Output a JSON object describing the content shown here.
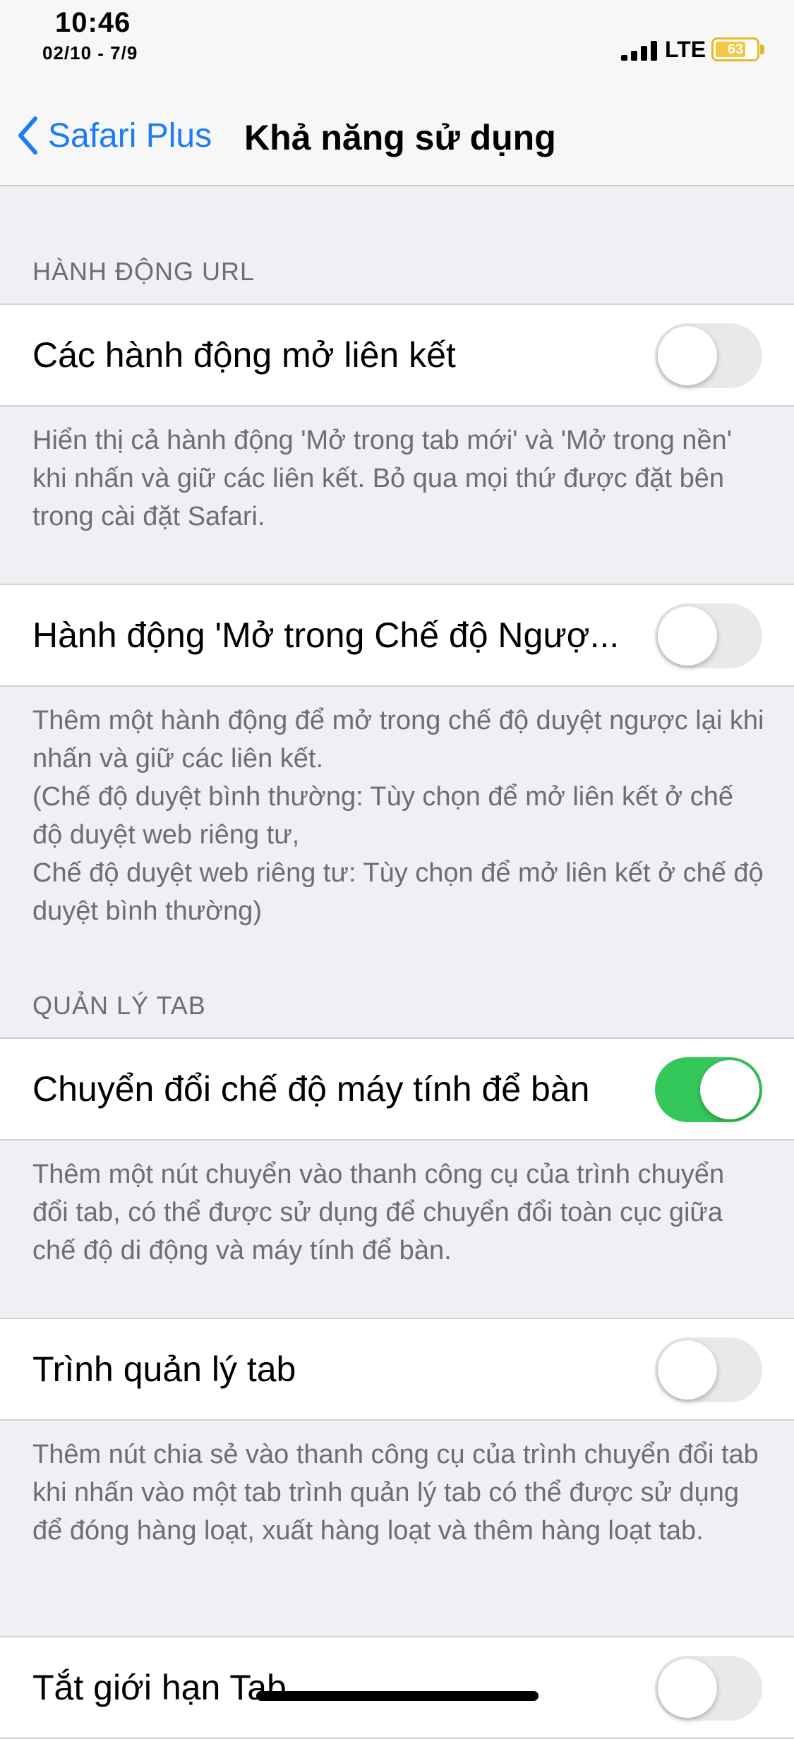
{
  "status_bar": {
    "time": "10:46",
    "date": "02/10 - 7/9",
    "network": "LTE",
    "battery": "63"
  },
  "nav": {
    "back_label": "Safari Plus",
    "title": "Khả năng sử dụng"
  },
  "sections": [
    {
      "header": "HÀNH ĐỘNG URL",
      "rows": [
        {
          "label": "Các hành động mở liên kết",
          "enabled": false,
          "footer": "Hiển thị cả hành động 'Mở trong tab mới' và 'Mở trong nền' khi nhấn và giữ các liên kết. Bỏ qua mọi thứ được đặt bên trong cài đặt Safari."
        },
        {
          "label": "Hành động 'Mở trong Chế độ Ngượ...",
          "enabled": false,
          "footer": "Thêm một hành động để mở trong chế độ duyệt ngược lại khi nhấn và giữ các liên kết.\n(Chế độ duyệt bình thường: Tùy chọn để mở liên kết ở chế độ duyệt web riêng tư,\nChế độ duyệt web riêng tư: Tùy chọn để mở liên kết ở chế độ duyệt bình thường)"
        }
      ]
    },
    {
      "header": "QUẢN LÝ TAB",
      "rows": [
        {
          "label": "Chuyển đổi chế độ máy tính để bàn",
          "enabled": true,
          "footer": "Thêm một nút chuyển vào thanh công cụ của trình chuyển đổi tab, có thể được sử dụng để chuyển đổi toàn cục giữa chế độ di động và máy tính để bàn."
        },
        {
          "label": "Trình quản lý tab",
          "enabled": false,
          "footer": "Thêm nút chia sẻ vào thanh công cụ của trình chuyển đổi tab khi nhấn vào một tab trình quản lý tab có thể được sử dụng để đóng hàng loạt, xuất hàng loạt và thêm hàng loạt tab."
        },
        {
          "label": "Tắt giới hạn Tab",
          "enabled": false
        }
      ]
    }
  ],
  "colors": {
    "accent": "#1b7cf5",
    "toggle_on": "#34c759",
    "toggle_off": "#e9e9ea",
    "background": "#efeff4"
  },
  "icons": [
    "signal-bars-icon",
    "battery-icon",
    "chevron-left-icon"
  ]
}
